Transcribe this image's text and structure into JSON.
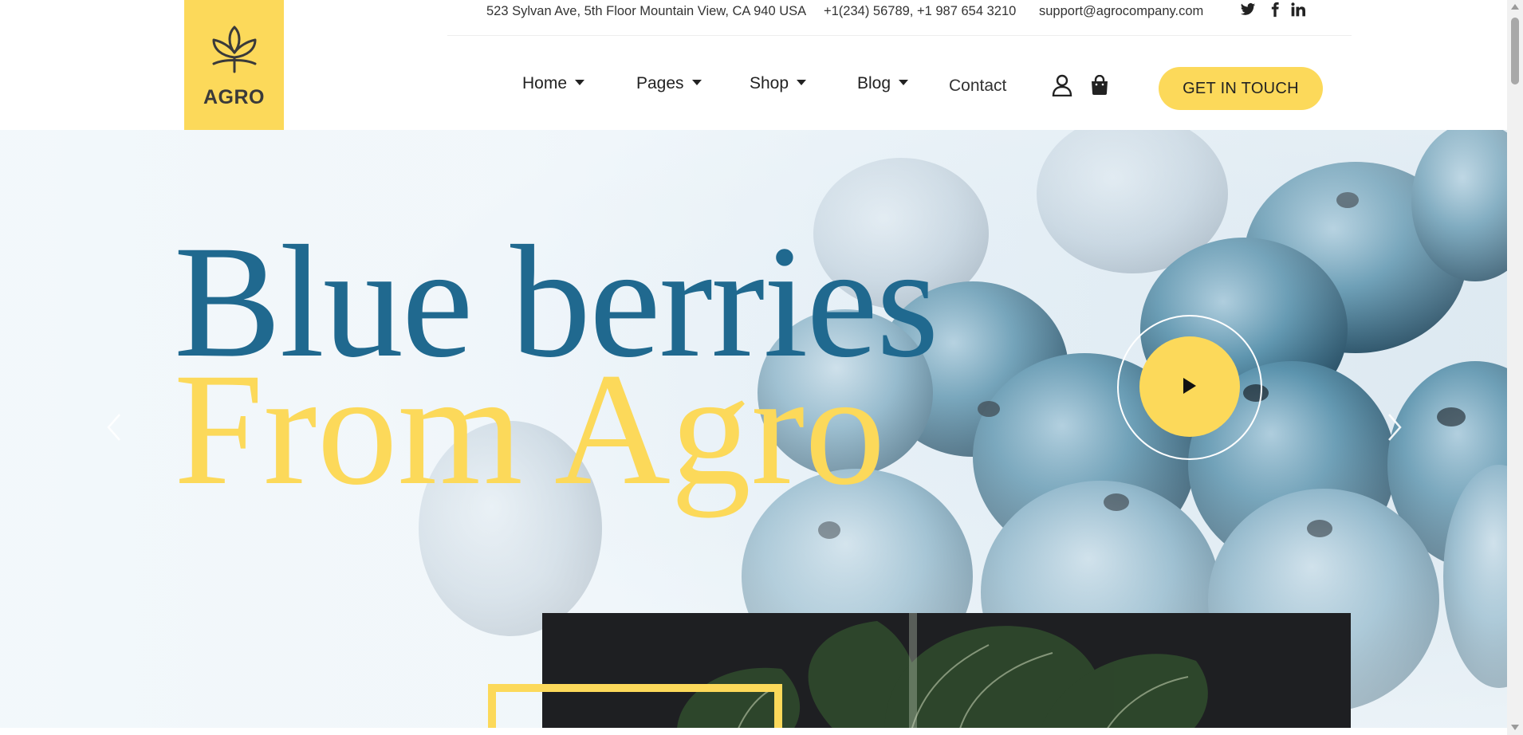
{
  "brand": {
    "logo_text": "AGRO",
    "accent_color": "#fcd95a",
    "headline_blue": "#20698f"
  },
  "topbar": {
    "address": "523 Sylvan Ave, 5th Floor Mountain View, CA 940 USA",
    "phone": "+1(234) 56789, +1 987 654 3210",
    "email": "support@agrocompany.com",
    "social": [
      "twitter-icon",
      "facebook-icon",
      "linkedin-icon"
    ]
  },
  "nav": {
    "items": [
      {
        "label": "Home",
        "has_dropdown": true
      },
      {
        "label": "Pages",
        "has_dropdown": true
      },
      {
        "label": "Shop",
        "has_dropdown": true
      },
      {
        "label": "Blog",
        "has_dropdown": true
      },
      {
        "label": "Contact",
        "has_dropdown": false
      }
    ],
    "icons": [
      "user-icon",
      "shopping-bag-icon"
    ],
    "cta_label": "GET IN TOUCH"
  },
  "hero": {
    "line1": "Blue berries",
    "line2": "From Agro",
    "controls": [
      "chevron-left-icon",
      "chevron-right-icon",
      "play-icon"
    ]
  }
}
